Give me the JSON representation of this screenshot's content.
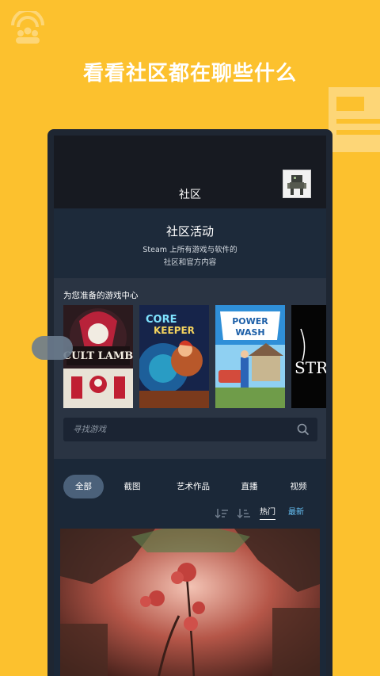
{
  "headline": "看看社区都在聊些什么",
  "app": {
    "title": "社区"
  },
  "community": {
    "heading": "社区活动",
    "line1": "Steam 上所有游戏与软件的",
    "line2": "社区和官方内容"
  },
  "hub": {
    "label": "为您准备的游戏中心",
    "games": [
      {
        "name": "cult-of-the-lamb",
        "title_art": "CULT OF THE LAMB"
      },
      {
        "name": "core-keeper",
        "title_art": "CORE KEEPER"
      },
      {
        "name": "powerwash-simulator",
        "title_art": "POWER WASH SIMULATOR"
      },
      {
        "name": "stray",
        "title_art": "STRAY"
      }
    ]
  },
  "search": {
    "placeholder": "寻找游戏"
  },
  "filters": {
    "all": "全部",
    "screenshots": "截图",
    "artwork": "艺术作品",
    "broadcasts": "直播",
    "videos": "视频"
  },
  "sort": {
    "hot": "热门",
    "latest": "最新"
  },
  "colors": {
    "background": "#FCC12E",
    "accent_blue": "#66C0F4",
    "panel": "#1B2838",
    "chip_active": "#4B617A"
  }
}
